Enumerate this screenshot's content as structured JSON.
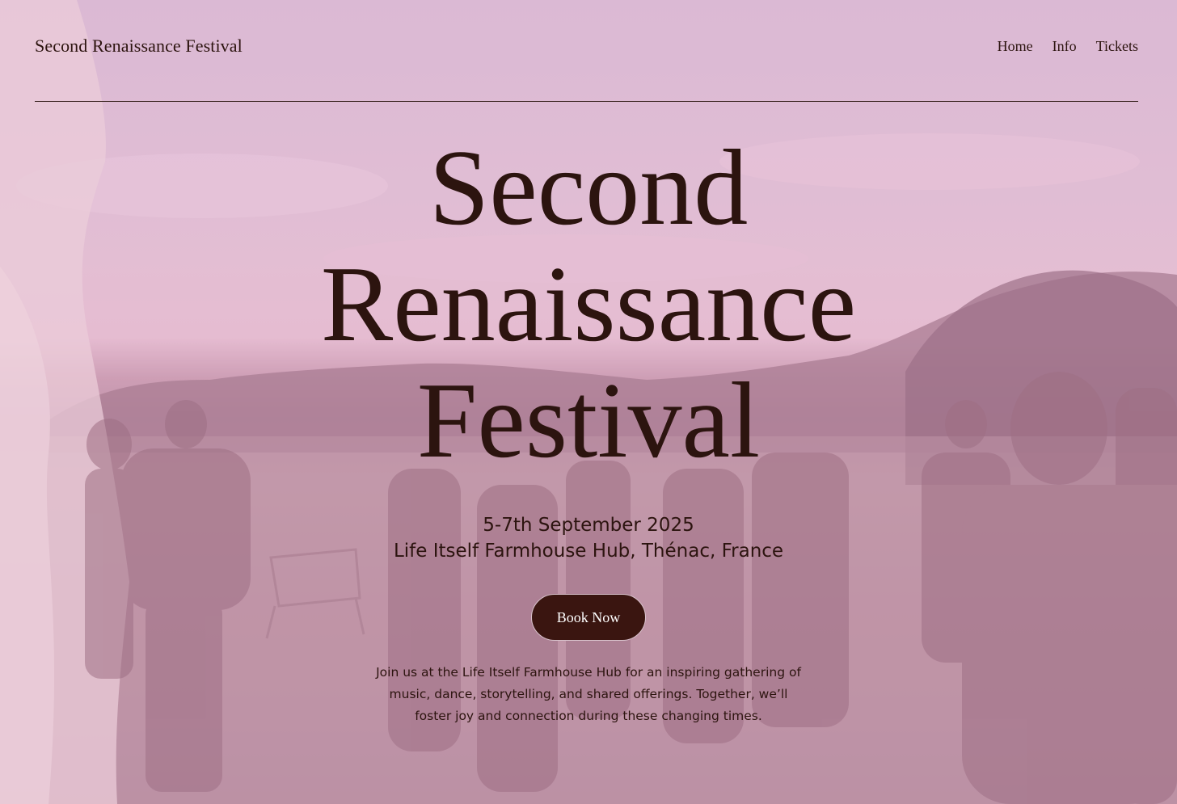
{
  "header": {
    "site_title": "Second Renaissance Festival",
    "nav": [
      {
        "label": "Home"
      },
      {
        "label": "Info"
      },
      {
        "label": "Tickets"
      }
    ]
  },
  "hero": {
    "title_lines": [
      "Second",
      "Renaissance",
      "Festival"
    ],
    "date": "5-7th September 2025",
    "location": "Life Itself Farmhouse Hub, Thénac, France",
    "button_label": "Book Now",
    "description": "Join us at the Life Itself Farmhouse Hub for an inspiring gathering of music, dance, storytelling, and shared offerings. Together, we’ll foster joy and connection during these changing times."
  },
  "colors": {
    "text": "#2c140f",
    "button_bg": "#3a1510",
    "button_text": "#ffffff",
    "overlay_tint": "#e8bed6"
  }
}
